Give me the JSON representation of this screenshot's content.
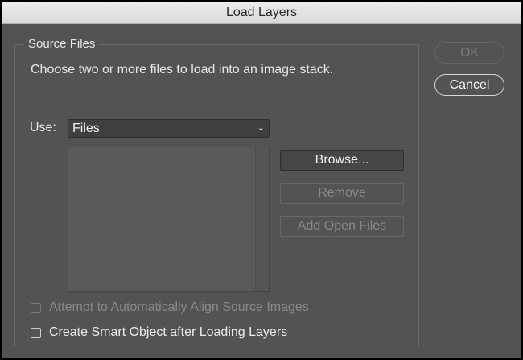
{
  "window": {
    "title": "Load Layers"
  },
  "source_files": {
    "legend": "Source Files",
    "description": "Choose two or more files to load into an image stack.",
    "use_label": "Use:",
    "use_value": "Files",
    "files": []
  },
  "buttons": {
    "browse": "Browse...",
    "remove": "Remove",
    "add_open_files": "Add Open Files",
    "ok": "OK",
    "cancel": "Cancel"
  },
  "options": {
    "auto_align": {
      "label": "Attempt to Automatically Align Source Images",
      "checked": false,
      "enabled": false
    },
    "smart_object": {
      "label": "Create Smart Object after Loading Layers",
      "checked": false,
      "enabled": true
    }
  }
}
